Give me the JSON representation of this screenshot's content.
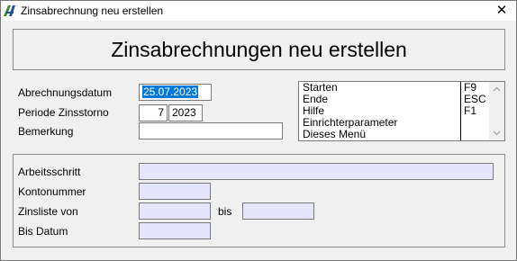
{
  "window": {
    "title": "Zinsabrechnung neu erstellen",
    "close_glyph": "✕",
    "icon": "app-logo-icon"
  },
  "banner": {
    "heading": "Zinsabrechnungen neu erstellen"
  },
  "form": {
    "abrechnungsdatum": {
      "label": "Abrechnungsdatum",
      "value": "25.07.2023"
    },
    "periode": {
      "label": "Periode Zinsstorno",
      "period_value": "7",
      "year_value": "2023"
    },
    "bemerkung": {
      "label": "Bemerkung",
      "value": ""
    }
  },
  "menu": {
    "items": [
      {
        "label": "Starten",
        "key": "F9"
      },
      {
        "label": "Ende",
        "key": "ESC"
      },
      {
        "label": "Hilfe",
        "key": "F1"
      },
      {
        "label": "Einrichterparameter",
        "key": ""
      },
      {
        "label": "Dieses Menü",
        "key": ""
      }
    ]
  },
  "details": {
    "arbeitsschritt": {
      "label": "Arbeitsschritt",
      "value": ""
    },
    "kontonummer": {
      "label": "Kontonummer",
      "value": ""
    },
    "zinsliste": {
      "label": "Zinsliste von",
      "from_value": "",
      "to_label": "bis",
      "to_value": ""
    },
    "bis_datum": {
      "label": "Bis Datum",
      "value": ""
    }
  },
  "colors": {
    "selection": "#0078d7",
    "readonly_field": "#e6e6fa",
    "window_bg": "#f0f0f0",
    "logo_green": "#3a8a3a",
    "logo_blue": "#1f4e9c"
  }
}
